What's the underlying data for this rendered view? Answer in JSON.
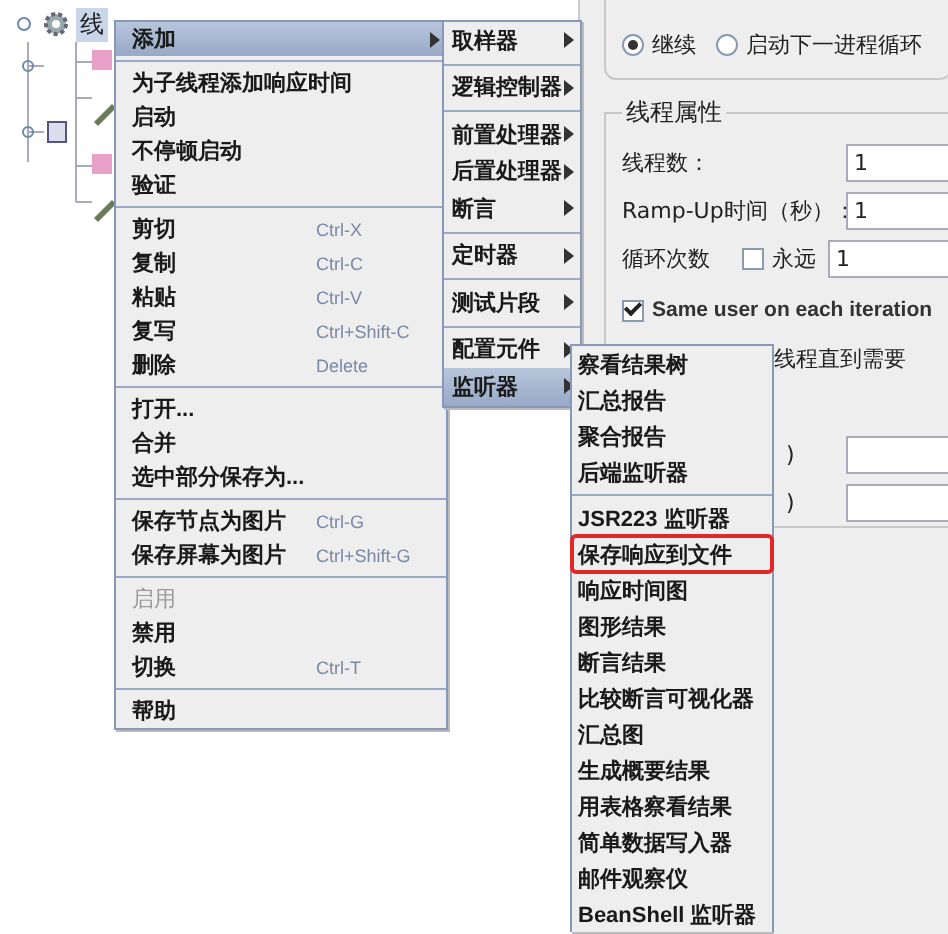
{
  "tree": {
    "node_label": "线"
  },
  "main_menu": {
    "items": [
      {
        "kind": "item",
        "label": "添加",
        "submenu": true,
        "selected": true,
        "disabled": false
      },
      {
        "kind": "separator"
      },
      {
        "kind": "item",
        "label": "为子线程添加响应时间",
        "submenu": false,
        "selected": false,
        "disabled": false
      },
      {
        "kind": "item",
        "label": "启动",
        "submenu": false,
        "selected": false,
        "disabled": false
      },
      {
        "kind": "item",
        "label": "不停顿启动",
        "submenu": false,
        "selected": false,
        "disabled": false
      },
      {
        "kind": "item",
        "label": "验证",
        "submenu": false,
        "selected": false,
        "disabled": false
      },
      {
        "kind": "separator"
      },
      {
        "kind": "item",
        "label": "剪切",
        "shortcut": "Ctrl-X",
        "submenu": false,
        "selected": false,
        "disabled": false
      },
      {
        "kind": "item",
        "label": "复制",
        "shortcut": "Ctrl-C",
        "submenu": false,
        "selected": false,
        "disabled": false
      },
      {
        "kind": "item",
        "label": "粘贴",
        "shortcut": "Ctrl-V",
        "submenu": false,
        "selected": false,
        "disabled": false
      },
      {
        "kind": "item",
        "label": "复写",
        "shortcut": "Ctrl+Shift-C",
        "submenu": false,
        "selected": false,
        "disabled": false
      },
      {
        "kind": "item",
        "label": "删除",
        "shortcut": "Delete",
        "submenu": false,
        "selected": false,
        "disabled": false
      },
      {
        "kind": "separator"
      },
      {
        "kind": "item",
        "label": "打开...",
        "submenu": false,
        "selected": false,
        "disabled": false
      },
      {
        "kind": "item",
        "label": "合并",
        "submenu": false,
        "selected": false,
        "disabled": false
      },
      {
        "kind": "item",
        "label": "选中部分保存为...",
        "submenu": false,
        "selected": false,
        "disabled": false
      },
      {
        "kind": "separator"
      },
      {
        "kind": "item",
        "label": "保存节点为图片",
        "shortcut": "Ctrl-G",
        "submenu": false,
        "selected": false,
        "disabled": false
      },
      {
        "kind": "item",
        "label": "保存屏幕为图片",
        "shortcut": "Ctrl+Shift-G",
        "submenu": false,
        "selected": false,
        "disabled": false
      },
      {
        "kind": "separator"
      },
      {
        "kind": "item",
        "label": "启用",
        "submenu": false,
        "selected": false,
        "disabled": true
      },
      {
        "kind": "item",
        "label": "禁用",
        "submenu": false,
        "selected": false,
        "disabled": false
      },
      {
        "kind": "item",
        "label": "切换",
        "shortcut": "Ctrl-T",
        "submenu": false,
        "selected": false,
        "disabled": false
      },
      {
        "kind": "separator"
      },
      {
        "kind": "item",
        "label": "帮助",
        "submenu": false,
        "selected": false,
        "disabled": false
      }
    ]
  },
  "add_submenu": {
    "items": [
      {
        "kind": "item",
        "label": "取样器",
        "submenu": true,
        "selected": false
      },
      {
        "kind": "separator"
      },
      {
        "kind": "item",
        "label": "逻辑控制器",
        "submenu": true,
        "selected": false
      },
      {
        "kind": "separator"
      },
      {
        "kind": "item",
        "label": "前置处理器",
        "submenu": true,
        "selected": false
      },
      {
        "kind": "item",
        "label": "后置处理器",
        "submenu": true,
        "selected": false
      },
      {
        "kind": "item",
        "label": "断言",
        "submenu": true,
        "selected": false
      },
      {
        "kind": "separator"
      },
      {
        "kind": "item",
        "label": "定时器",
        "submenu": true,
        "selected": false
      },
      {
        "kind": "separator"
      },
      {
        "kind": "item",
        "label": "测试片段",
        "submenu": true,
        "selected": false
      },
      {
        "kind": "separator"
      },
      {
        "kind": "item",
        "label": "配置元件",
        "submenu": true,
        "selected": false
      },
      {
        "kind": "item",
        "label": "监听器",
        "submenu": true,
        "selected": true
      }
    ]
  },
  "listener_submenu": {
    "items": [
      {
        "kind": "item",
        "label": "察看结果树",
        "marked": false
      },
      {
        "kind": "item",
        "label": "汇总报告",
        "marked": false
      },
      {
        "kind": "item",
        "label": "聚合报告",
        "marked": false
      },
      {
        "kind": "item",
        "label": "后端监听器",
        "marked": false
      },
      {
        "kind": "separator"
      },
      {
        "kind": "item",
        "label": "JSR223 监听器",
        "marked": false
      },
      {
        "kind": "item",
        "label": "保存响应到文件",
        "marked": true
      },
      {
        "kind": "item",
        "label": "响应时间图",
        "marked": false
      },
      {
        "kind": "item",
        "label": "图形结果",
        "marked": false
      },
      {
        "kind": "item",
        "label": "断言结果",
        "marked": false
      },
      {
        "kind": "item",
        "label": "比较断言可视化器",
        "marked": false
      },
      {
        "kind": "item",
        "label": "汇总图",
        "marked": false
      },
      {
        "kind": "item",
        "label": "生成概要结果",
        "marked": false
      },
      {
        "kind": "item",
        "label": "用表格察看结果",
        "marked": false
      },
      {
        "kind": "item",
        "label": "简单数据写入器",
        "marked": false
      },
      {
        "kind": "item",
        "label": "邮件观察仪",
        "marked": false
      },
      {
        "kind": "item",
        "label": "BeanShell 监听器",
        "marked": false
      }
    ]
  },
  "settings": {
    "action_radios": [
      {
        "label": "继续",
        "selected": true
      },
      {
        "label": "启动下一进程循环",
        "selected": false
      }
    ],
    "thread_properties": {
      "title": "线程属性",
      "fields": [
        {
          "label": "线程数：",
          "value": "1"
        },
        {
          "label": "Ramp-Up时间（秒）：",
          "value": "1"
        }
      ],
      "loop": {
        "label": "循环次数",
        "forever_label": "永远",
        "forever_checked": false,
        "value": "1"
      },
      "same_user": {
        "label": "Same user on each iteration",
        "checked": true
      },
      "delay_label": "线程直到需要",
      "partial_labels": [
        ")",
        ")"
      ]
    }
  }
}
